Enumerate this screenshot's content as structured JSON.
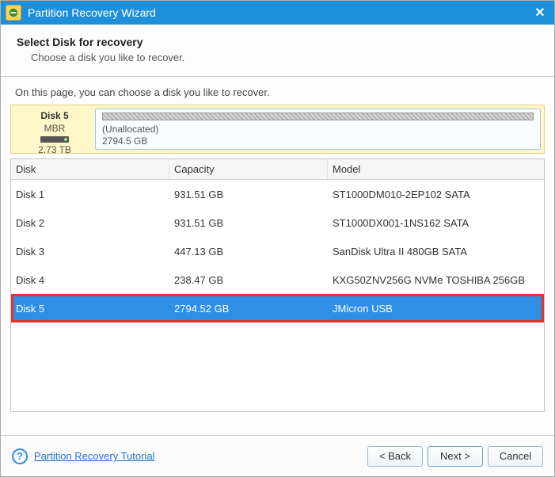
{
  "window": {
    "title": "Partition Recovery Wizard"
  },
  "header": {
    "title": "Select Disk for recovery",
    "subtitle": "Choose a disk you like to recover."
  },
  "instruction": "On this page, you can choose a disk you like to recover.",
  "selected_disk_panel": {
    "name": "Disk 5",
    "scheme": "MBR",
    "size": "2.73 TB",
    "segment_label": "(Unallocated)",
    "segment_size": "2794.5 GB"
  },
  "table": {
    "headers": {
      "disk": "Disk",
      "capacity": "Capacity",
      "model": "Model"
    },
    "rows": [
      {
        "disk": "Disk 1",
        "capacity": "931.51 GB",
        "model": "ST1000DM010-2EP102 SATA",
        "selected": false
      },
      {
        "disk": "Disk 2",
        "capacity": "931.51 GB",
        "model": "ST1000DX001-1NS162 SATA",
        "selected": false
      },
      {
        "disk": "Disk 3",
        "capacity": "447.13 GB",
        "model": "SanDisk Ultra II 480GB SATA",
        "selected": false
      },
      {
        "disk": "Disk 4",
        "capacity": "238.47 GB",
        "model": "KXG50ZNV256G NVMe TOSHIBA 256GB",
        "selected": false
      },
      {
        "disk": "Disk 5",
        "capacity": "2794.52 GB",
        "model": "JMicron  USB",
        "selected": true
      }
    ]
  },
  "footer": {
    "help_link": "Partition Recovery Tutorial",
    "back": "< Back",
    "next": "Next >",
    "cancel": "Cancel"
  }
}
